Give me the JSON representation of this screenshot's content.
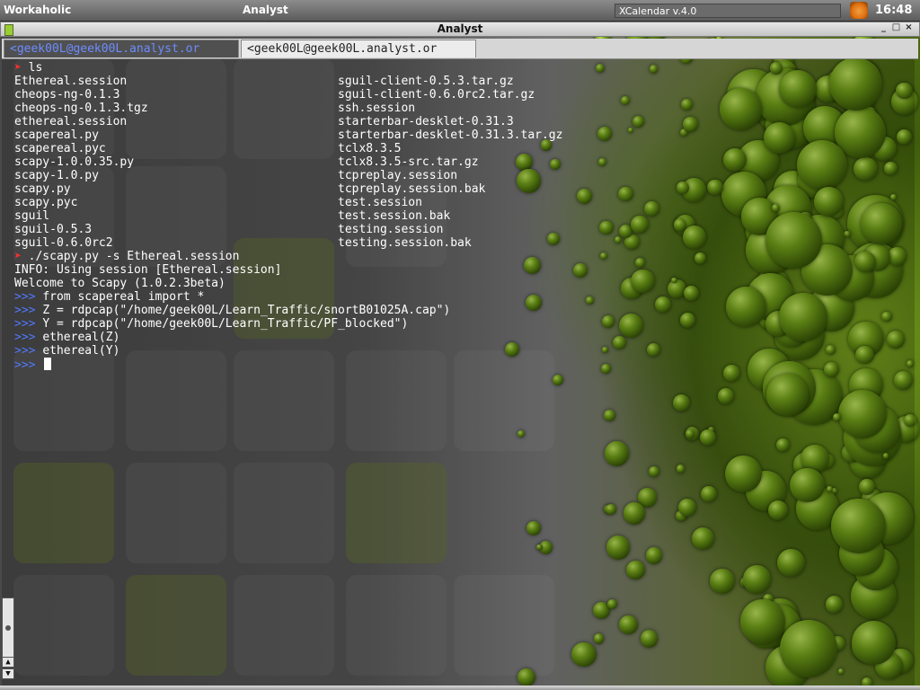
{
  "topbar": {
    "left_label": "Workaholic",
    "center_label": "Analyst",
    "calendar_label": "XCalendar v.4.0",
    "clock": "16:48"
  },
  "window": {
    "title": "Analyst",
    "controls": [
      "_",
      "□",
      "×"
    ]
  },
  "tabs": [
    {
      "label": "<geek00L@geek00L.analyst.or",
      "active": true
    },
    {
      "label": "<geek00L@geek00L.analyst.or",
      "active": false
    }
  ],
  "terminal": {
    "cmd1": "ls",
    "ls_left": [
      "Ethereal.session",
      "cheops-ng-0.1.3",
      "cheops-ng-0.1.3.tgz",
      "ethereal.session",
      "scapereal.py",
      "scapereal.pyc",
      "scapy-1.0.0.35.py",
      "scapy-1.0.py",
      "scapy.py",
      "scapy.pyc",
      "sguil",
      "sguil-0.5.3",
      "sguil-0.6.0rc2"
    ],
    "ls_right": [
      "sguil-client-0.5.3.tar.gz",
      "sguil-client-0.6.0rc2.tar.gz",
      "ssh.session",
      "starterbar-desklet-0.31.3",
      "starterbar-desklet-0.31.3.tar.gz",
      "tclx8.3.5",
      "tclx8.3.5-src.tar.gz",
      "tcpreplay.session",
      "tcpreplay.session.bak",
      "test.session",
      "test.session.bak",
      "testing.session",
      "testing.session.bak"
    ],
    "cmd2": "./scapy.py -s Ethereal.session",
    "info": "INFO: Using session [Ethereal.session]",
    "welcome": "Welcome to Scapy (1.0.2.3beta)",
    "py_prompt": ">>>",
    "py_lines": [
      "from scapereal import *",
      "Z = rdpcap(\"/home/geek00L/Learn_Traffic/snortB01025A.cap\")",
      "Y = rdpcap(\"/home/geek00L/Learn_Traffic/PF_blocked\")",
      "ethereal(Z)",
      "ethereal(Y)",
      ""
    ],
    "shell_prompt_glyph": "➤"
  },
  "scrollbar": {
    "up": "▲",
    "down": "▼"
  },
  "colors": {
    "prompt": "#ff3030",
    "py_prompt": "#5078ff",
    "active_tab_text": "#6d8cff"
  }
}
